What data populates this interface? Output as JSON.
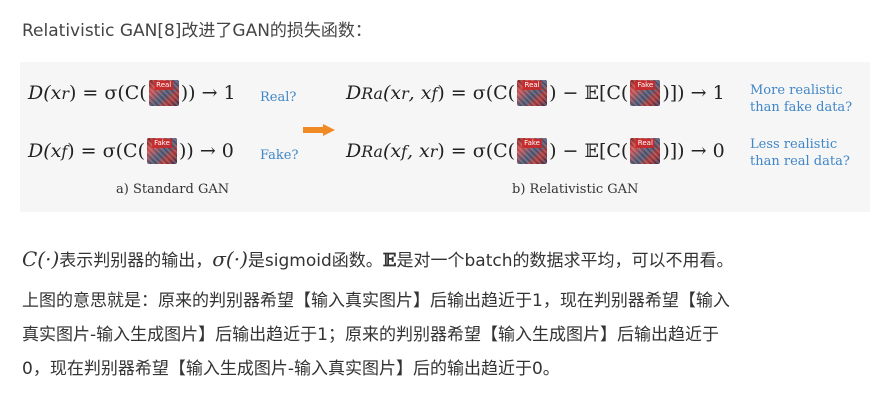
{
  "intro": "Relativistic GAN[8]改进了GAN的损失函数：",
  "figure": {
    "standard": {
      "eq1_left": "D(x",
      "eq1_sub": "r",
      "eq1_mid": ") = σ(C(",
      "eq1_right": ")) → 1",
      "eq1_thumb": "Real",
      "eq1_note": "Real?",
      "eq2_left": "D(x",
      "eq2_sub": "f",
      "eq2_mid": ") = σ(C(",
      "eq2_right": ")) → 0",
      "eq2_thumb": "Fake",
      "eq2_note": "Fake?",
      "caption": "a) Standard GAN"
    },
    "relativistic": {
      "eq1_left": "D",
      "eq1_sub": "Ra",
      "eq1_args": "(x",
      "eq1_args_sub1": "r",
      "eq1_args_mid": ", x",
      "eq1_args_sub2": "f",
      "eq1_mid": ") = σ(C(",
      "eq1_minus": ") − 𝔼[C(",
      "eq1_right": ")]) → 1",
      "eq1_thumb_a": "Real",
      "eq1_thumb_b": "Fake",
      "eq1_note_l1": "More realistic",
      "eq1_note_l2": "than fake data?",
      "eq2_left": "D",
      "eq2_sub": "Ra",
      "eq2_args": "(x",
      "eq2_args_sub1": "f",
      "eq2_args_mid": ", x",
      "eq2_args_sub2": "r",
      "eq2_mid": ") = σ(C(",
      "eq2_minus": ") − 𝔼[C(",
      "eq2_right": ")]) → 0",
      "eq2_thumb_a": "Fake",
      "eq2_thumb_b": "Real",
      "eq2_note_l1": "Less realistic",
      "eq2_note_l2": "than real data?",
      "caption": "b) Relativistic GAN"
    },
    "arrow_color": "#f08a24"
  },
  "para": {
    "math_c": "C(·)",
    "text1": "表示判别器的输出，",
    "math_sigma": "σ(·)",
    "text2": "是sigmoid函数。",
    "math_e": "𝔼",
    "text3": "是对一个batch的数据求平均，可以不用看。",
    "line2": "上图的意思就是：原来的判别器希望【输入真实图片】后输出趋近于1，现在判别器希望【输入",
    "line3": "真实图片-输入生成图片】后输出趋近于1；原来的判别器希望【输入生成图片】后输出趋近于",
    "line4": "0，现在判别器希望【输入生成图片-输入真实图片】后的输出趋近于0。"
  }
}
